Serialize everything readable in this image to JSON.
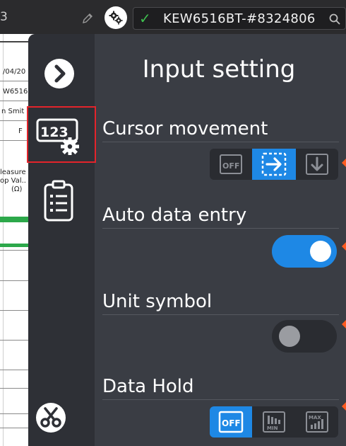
{
  "header": {
    "edge_text": "3",
    "device_name": "KEW6516BT-#8324806"
  },
  "sheet": {
    "cells": [
      {
        "text": "/04/20"
      },
      {
        "text": "W6516"
      },
      {
        "text": "n Smit"
      },
      {
        "text": "F"
      },
      {
        "text": "leasure"
      },
      {
        "text": "op Val.."
      },
      {
        "text": "(Ω)"
      }
    ]
  },
  "panel": {
    "title": "Input setting",
    "settings": {
      "cursor_movement": {
        "label": "Cursor movement",
        "options": [
          "off-icon",
          "arrow-right-icon",
          "arrow-down-icon"
        ],
        "selected": 1
      },
      "auto_data_entry": {
        "label": "Auto data entry",
        "on": true
      },
      "unit_symbol": {
        "label": "Unit symbol",
        "on": false
      },
      "data_hold": {
        "label": "Data Hold",
        "options": [
          "off-icon",
          "min-hold-icon",
          "max-hold-icon"
        ],
        "selected": 0
      }
    }
  },
  "icons": {
    "pencil": "pencil-icon",
    "gear": "gear-icon",
    "check": "check-icon",
    "search": "search-icon",
    "forward": "chevron-right-icon",
    "input_setting": "input-setting-icon",
    "clipboard": "clipboard-list-icon",
    "scissors": "scissors-icon"
  },
  "colors": {
    "accent": "#1e88e5",
    "panel": "#3a3d44",
    "rail": "#2e3036",
    "highlight_box": "#e3242b",
    "marker": "#ff5a1f",
    "connected": "#3fbf4f"
  }
}
